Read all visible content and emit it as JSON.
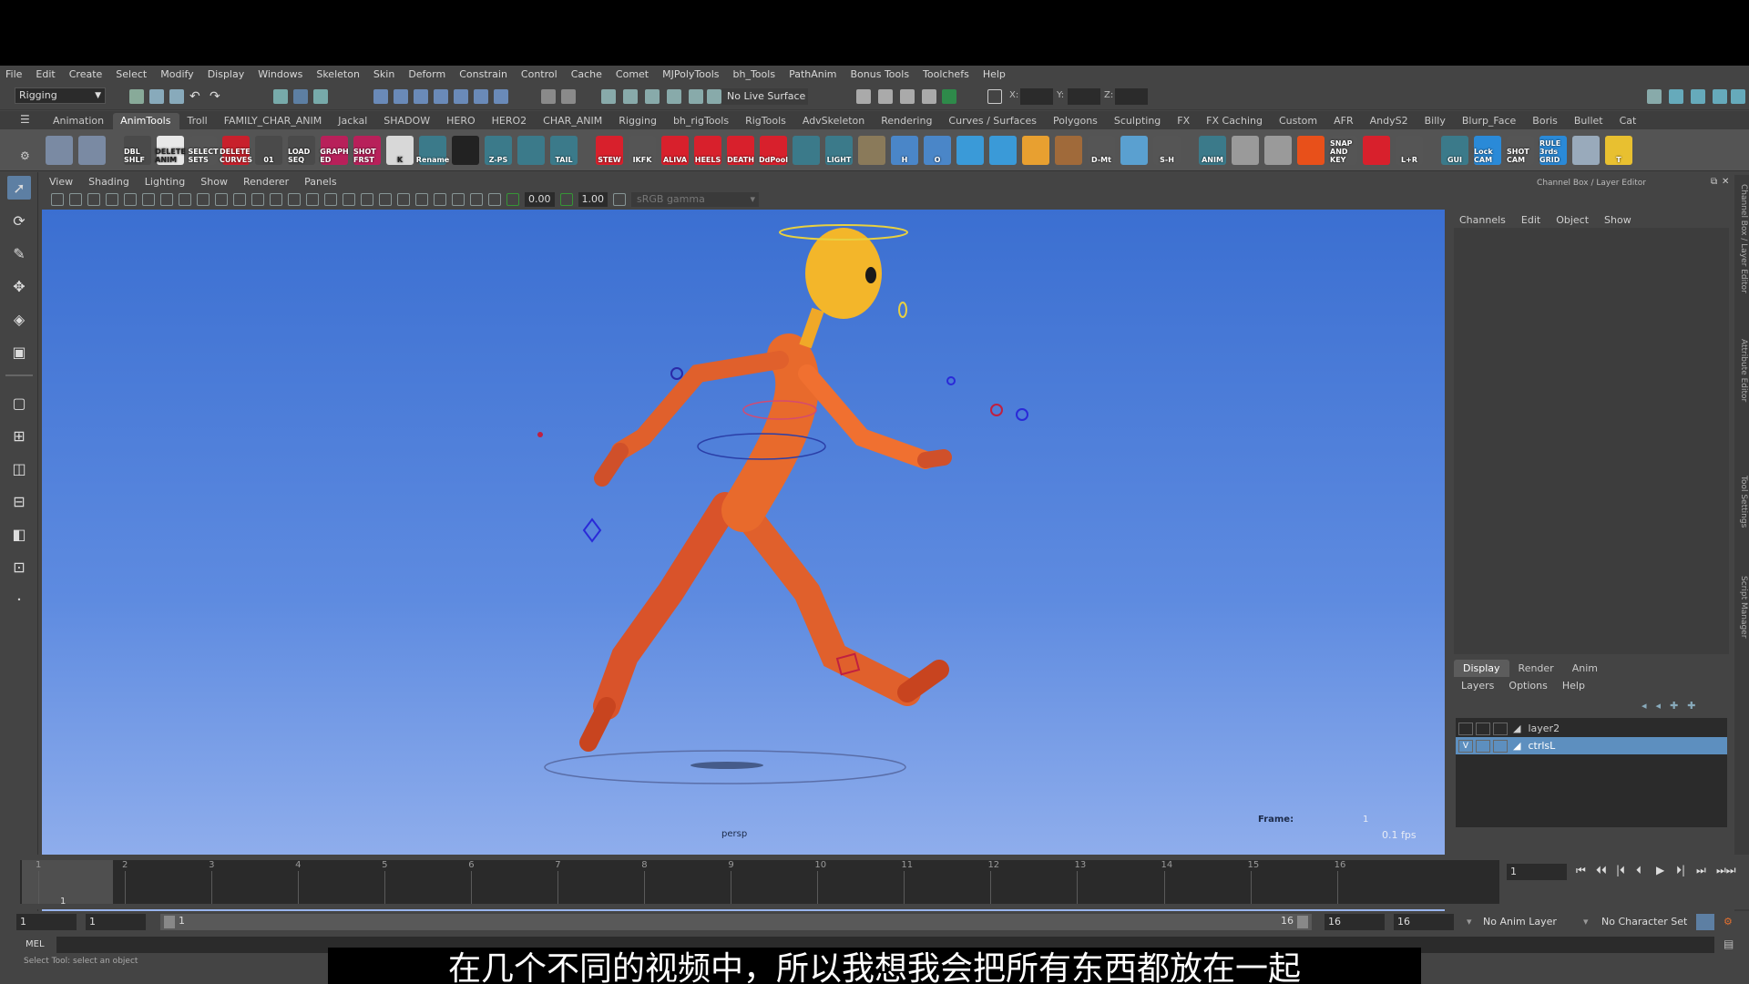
{
  "menu": [
    "File",
    "Edit",
    "Create",
    "Select",
    "Modify",
    "Display",
    "Windows",
    "Skeleton",
    "Skin",
    "Deform",
    "Constrain",
    "Control",
    "Cache",
    "Comet",
    "MJPolyTools",
    "bh_Tools",
    "PathAnim",
    "Bonus Tools",
    "Toolchefs",
    "Help"
  ],
  "status_line": {
    "mode": "Rigging",
    "live_surface": "No Live Surface",
    "x_label": "X:",
    "y_label": "Y:",
    "z_label": "Z:"
  },
  "shelf_tabs": [
    "Animation",
    "AnimTools",
    "Troll",
    "FAMILY_CHAR_ANIM",
    "Jackal",
    "SHADOW",
    "HERO",
    "HERO2",
    "CHAR_ANIM",
    "Rigging",
    "bh_rigTools",
    "RigTools",
    "AdvSkeleton",
    "Rendering",
    "Curves / Surfaces",
    "Polygons",
    "Sculpting",
    "FX",
    "FX Caching",
    "Custom",
    "AFR",
    "AndyS2",
    "Billy",
    "Blurp_Face",
    "Boris",
    "Bullet",
    "Cat"
  ],
  "shelf_active_tab": "AnimTools",
  "shelf_buttons": [
    {
      "label": "",
      "color": "#7a8aa3"
    },
    {
      "label": "",
      "color": "#7a8aa3"
    },
    {
      "label": "DBL SHLF",
      "color": "#4a4a4a"
    },
    {
      "label": "DELETE ANIM",
      "color": "#e8e8e8"
    },
    {
      "label": "SELECT SETS",
      "color": "#555"
    },
    {
      "label": "DELETE CURVES",
      "color": "#c8202c"
    },
    {
      "label": "01",
      "color": "#4a4a4a"
    },
    {
      "label": "LOAD SEQ",
      "color": "#4a4a4a"
    },
    {
      "label": "GRAPH ED",
      "color": "#b8205a"
    },
    {
      "label": "SHOT FRST",
      "color": "#b8205a"
    },
    {
      "label": "K",
      "color": "#d8d8d8"
    },
    {
      "label": "Rename",
      "color": "#3b7a8a"
    },
    {
      "label": "",
      "color": "#222"
    },
    {
      "label": "Z-PS",
      "color": "#3b7a8a"
    },
    {
      "label": "",
      "color": "#3b7a8a"
    },
    {
      "label": "TAIL",
      "color": "#3b7a8a"
    },
    {
      "label": "STEW",
      "color": "#d8202c"
    },
    {
      "label": "IKFK",
      "color": "#555"
    },
    {
      "label": "ALIVA",
      "color": "#d8202c"
    },
    {
      "label": "HEELS",
      "color": "#d8202c"
    },
    {
      "label": "DEATH",
      "color": "#d8202c"
    },
    {
      "label": "DdPool",
      "color": "#d8202c"
    },
    {
      "label": "",
      "color": "#3b7a8a"
    },
    {
      "label": "LIGHT",
      "color": "#3b7a8a"
    },
    {
      "label": "",
      "color": "#8a7a5a"
    },
    {
      "label": "H",
      "color": "#4a86c8"
    },
    {
      "label": "O",
      "color": "#4a86c8"
    },
    {
      "label": "",
      "color": "#3a9ad8"
    },
    {
      "label": "",
      "color": "#3a9ad8"
    },
    {
      "label": "",
      "color": "#e8a030"
    },
    {
      "label": "",
      "color": "#a06a3a"
    },
    {
      "label": "D-Mt",
      "color": "#555"
    },
    {
      "label": "",
      "color": "#5aa0d0"
    },
    {
      "label": "S-H",
      "color": "#555"
    },
    {
      "label": "ANIM",
      "color": "#3b7a8a"
    },
    {
      "label": "",
      "color": "#9a9a9a"
    },
    {
      "label": "",
      "color": "#9a9a9a"
    },
    {
      "label": "",
      "color": "#e8501a"
    },
    {
      "label": "SNAP AND KEY",
      "color": "#555"
    },
    {
      "label": "",
      "color": "#d8202c"
    },
    {
      "label": "L+R",
      "color": "#555"
    },
    {
      "label": "GUI",
      "color": "#3b7a8a"
    },
    {
      "label": "Lock CAM",
      "color": "#2a8ad8"
    },
    {
      "label": "SHOT CAM",
      "color": "#555"
    },
    {
      "label": "RULE 3rds GRID",
      "color": "#2a8ad8"
    },
    {
      "label": "",
      "color": "#9ab"
    },
    {
      "label": "T",
      "color": "#e8c030"
    }
  ],
  "panel_menu": [
    "View",
    "Shading",
    "Lighting",
    "Show",
    "Renderer",
    "Panels"
  ],
  "panel_toolbar": {
    "near_value": "0.00",
    "far_value": "1.00",
    "color_space": "sRGB gamma"
  },
  "viewport": {
    "frame_label": "Frame:",
    "frame_value": "1",
    "fps": "0.1 fps",
    "camera": "persp"
  },
  "channel_box": {
    "title": "Channel Box / Layer Editor",
    "menu": [
      "Channels",
      "Edit",
      "Object",
      "Show"
    ]
  },
  "layer_editor": {
    "tabs": [
      "Display",
      "Render",
      "Anim"
    ],
    "active_tab": "Display",
    "menu": [
      "Layers",
      "Options",
      "Help"
    ],
    "layers": [
      {
        "name": "layer2",
        "visible_flag": "",
        "selected": false
      },
      {
        "name": "ctrlsL",
        "visible_flag": "V",
        "selected": true
      }
    ]
  },
  "side_tabs": [
    "Channel Box / Layer Editor",
    "Attribute Editor",
    "Tool Settings",
    "Script Manager"
  ],
  "timeline": {
    "ticks": [
      "1",
      "2",
      "3",
      "4",
      "5",
      "6",
      "7",
      "8",
      "9",
      "10",
      "11",
      "12",
      "13",
      "14",
      "15",
      "16"
    ],
    "current_frame": "1",
    "current_frame_field": "1",
    "controls": [
      "⏮",
      "⏴⏴",
      "|⏴",
      "⏴",
      "▶",
      "⏵|",
      "⏭",
      "⏭⏭"
    ]
  },
  "range": {
    "start": "1",
    "playback_start": "1",
    "slider_start": "1",
    "slider_end": "16",
    "playback_end": "16",
    "end": "16",
    "anim_layer": "No Anim Layer",
    "character_set": "No Character Set"
  },
  "command_line": {
    "label": "MEL",
    "help_text": "Select Tool: select an object"
  },
  "subtitle": "在几个不同的视频中，所以我想我会把所有东西都放在一起"
}
